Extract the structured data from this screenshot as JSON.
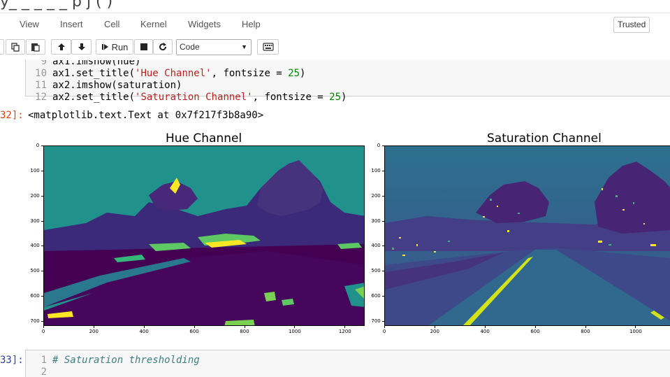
{
  "window": {
    "title_fragment": "y_ _ _ _ _   p   j   (  )"
  },
  "menu": {
    "items": [
      "View",
      "Insert",
      "Cell",
      "Kernel",
      "Widgets",
      "Help"
    ],
    "trusted_label": "Trusted"
  },
  "toolbar": {
    "run_label": "Run",
    "cell_type": "Code",
    "icons": [
      "copy-icon",
      "paste-icon",
      "arrow-up-icon",
      "arrow-down-icon",
      "run-icon",
      "stop-icon",
      "restart-icon",
      "keyboard-icon"
    ]
  },
  "cell1": {
    "code": [
      {
        "ln": "9",
        "text": "ax1.imshow(hue)"
      },
      {
        "ln": "10",
        "pre": "ax1.set_title(",
        "str": "'Hue Channel'",
        "mid": ", fontsize = ",
        "num": "25",
        "post": ")"
      },
      {
        "ln": "11",
        "text": "ax2.imshow(saturation)"
      },
      {
        "ln": "12",
        "pre": "ax2.set_title(",
        "str": "'Saturation Channel'",
        "mid": ", fontsize = ",
        "num": "25",
        "post": ")"
      }
    ],
    "out_prompt": "32]:",
    "output_text": "<matplotlib.text.Text at 0x7f217f3b8a90>"
  },
  "plots": {
    "left": {
      "title": "Hue Channel",
      "yticks": [
        "0",
        "100",
        "200",
        "300",
        "400",
        "500",
        "600",
        "700"
      ],
      "xticks": [
        "0",
        "200",
        "400",
        "600",
        "800",
        "1000",
        "1200"
      ]
    },
    "right": {
      "title": "Saturation Channel",
      "yticks": [
        "0",
        "100",
        "200",
        "300",
        "400",
        "500",
        "600",
        "700"
      ],
      "xticks": [
        "0",
        "200",
        "400",
        "600",
        "800",
        "1000"
      ]
    }
  },
  "cell2": {
    "in_prompt": "33]:",
    "lines": [
      {
        "ln": "1",
        "comment": "# Saturation thresholding"
      },
      {
        "ln": "2",
        "comment": ""
      }
    ]
  },
  "colors": {
    "viridis_purple": "#440154",
    "viridis_teal": "#21918c",
    "viridis_yellow": "#fde725",
    "viridis_green": "#5ec962",
    "viridis_blue": "#3b528b",
    "in_prompt": "#303f9f",
    "out_prompt": "#d84315"
  }
}
